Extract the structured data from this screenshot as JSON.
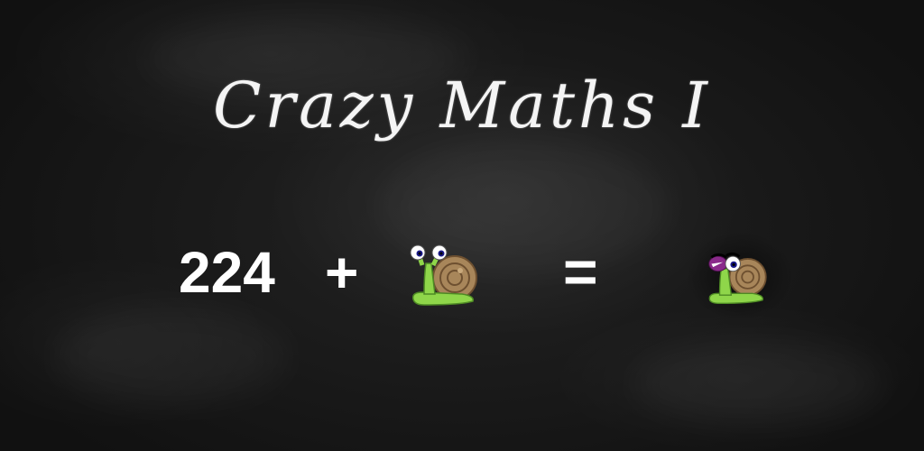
{
  "game": {
    "title": "Crazy Maths I",
    "equation": {
      "number": "224",
      "plus": "+",
      "equals": "=",
      "operand_icon": "snail-icon",
      "result_icon": "winking-snail-icon"
    }
  },
  "colors": {
    "board": "#1a1a1a",
    "chalk": "#ffffff",
    "snail_body": "#8fd64a",
    "snail_shell": "#a8865a",
    "snail_eye_lid": "#8a2a8a"
  }
}
